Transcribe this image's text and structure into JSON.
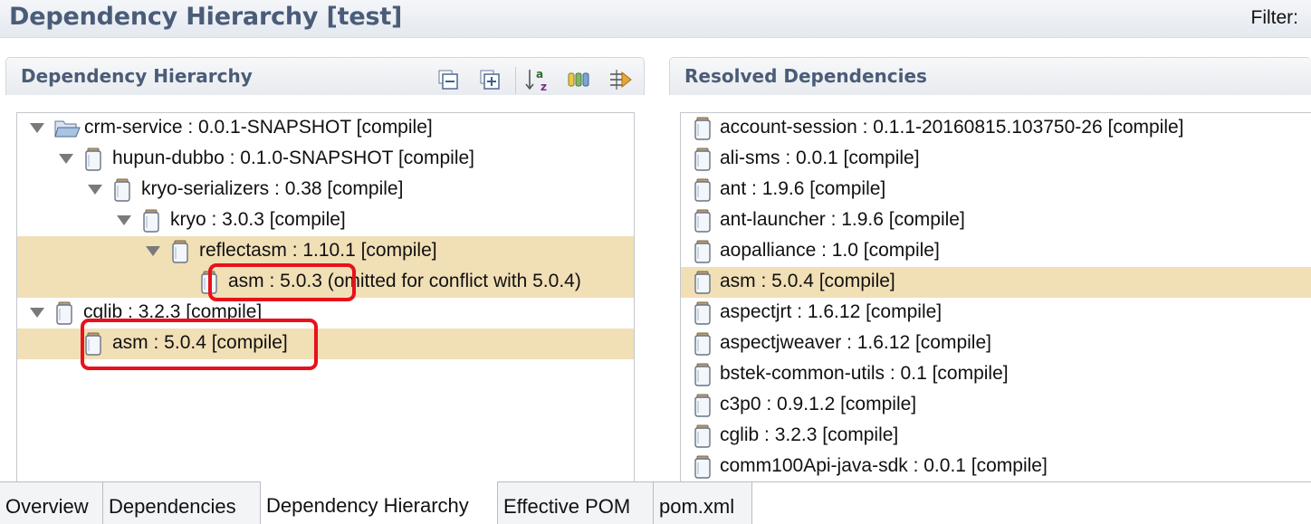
{
  "editor": {
    "title": "Dependency Hierarchy [test]",
    "filter_label": "Filter:"
  },
  "left_panel": {
    "title": "Dependency Hierarchy",
    "toolbar": [
      {
        "name": "collapse-all-icon"
      },
      {
        "name": "expand-all-icon"
      },
      {
        "name": "sort-az-icon"
      },
      {
        "name": "show-group-id-icon"
      },
      {
        "name": "filter-icon"
      }
    ],
    "tree": [
      {
        "label": "crm-service : 0.0.1-SNAPSHOT [compile]",
        "depth": 0,
        "expanded": true,
        "icon": "project-folder-icon",
        "highlight": false
      },
      {
        "label": "hupun-dubbo : 0.1.0-SNAPSHOT [compile]",
        "depth": 1,
        "expanded": true,
        "icon": "jar-icon",
        "highlight": false
      },
      {
        "label": "kryo-serializers : 0.38 [compile]",
        "depth": 2,
        "expanded": true,
        "icon": "jar-icon",
        "highlight": false
      },
      {
        "label": "kryo : 3.0.3 [compile]",
        "depth": 3,
        "expanded": true,
        "icon": "jar-icon",
        "highlight": false
      },
      {
        "label": "reflectasm : 1.10.1 [compile]",
        "depth": 4,
        "expanded": true,
        "icon": "jar-icon",
        "highlight": true
      },
      {
        "label": "asm : 5.0.3 (omitted for conflict with 5.0.4)",
        "depth": 5,
        "expanded": null,
        "icon": "jar-icon",
        "highlight": true
      },
      {
        "label": "cglib : 3.2.3 [compile]",
        "depth": 0,
        "expanded": true,
        "icon": "jar-icon",
        "highlight": false
      },
      {
        "label": "asm : 5.0.4 [compile]",
        "depth": 1,
        "expanded": null,
        "icon": "jar-icon",
        "highlight": true
      }
    ]
  },
  "right_panel": {
    "title": "Resolved Dependencies",
    "items": [
      {
        "label": "account-session : 0.1.1-20160815.103750-26 [compile]",
        "highlight": false
      },
      {
        "label": "ali-sms : 0.0.1 [compile]",
        "highlight": false
      },
      {
        "label": "ant : 1.9.6 [compile]",
        "highlight": false
      },
      {
        "label": "ant-launcher : 1.9.6 [compile]",
        "highlight": false
      },
      {
        "label": "aopalliance : 1.0 [compile]",
        "highlight": false
      },
      {
        "label": "asm : 5.0.4 [compile]",
        "highlight": true
      },
      {
        "label": "aspectjrt : 1.6.12 [compile]",
        "highlight": false
      },
      {
        "label": "aspectjweaver : 1.6.12 [compile]",
        "highlight": false
      },
      {
        "label": "bstek-common-utils : 0.1 [compile]",
        "highlight": false
      },
      {
        "label": "c3p0 : 0.9.1.2 [compile]",
        "highlight": false
      },
      {
        "label": "cglib : 3.2.3 [compile]",
        "highlight": false
      },
      {
        "label": "comm100Api-java-sdk : 0.0.1 [compile]",
        "highlight": false
      }
    ]
  },
  "tabs": [
    {
      "label": "Overview",
      "active": false
    },
    {
      "label": "Dependencies",
      "active": false
    },
    {
      "label": "Dependency Hierarchy",
      "active": true
    },
    {
      "label": "Effective POM",
      "active": false
    },
    {
      "label": "pom.xml",
      "active": false
    }
  ],
  "colors": {
    "highlight": "#f1dfb6",
    "annotation_red": "#e8111b",
    "header_text": "#4a5c78"
  }
}
